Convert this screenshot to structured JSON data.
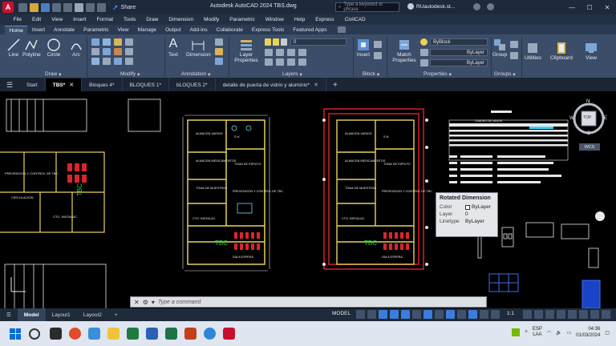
{
  "window": {
    "title": "Autodesk AutoCAD 2024    TBS.dwg",
    "app_letter": "A",
    "share_label": "Share",
    "search_placeholder": "Type a keyword or phrase",
    "user_name": "RUautodesk.st...",
    "controls": [
      "—",
      "☐",
      "✕"
    ]
  },
  "menu": [
    "File",
    "Edit",
    "View",
    "Insert",
    "Format",
    "Tools",
    "Draw",
    "Dimension",
    "Modify",
    "Parametric",
    "Window",
    "Help",
    "Express",
    "CivilCAD"
  ],
  "ribbon_tabs": [
    "Home",
    "Insert",
    "Annotate",
    "Parametric",
    "View",
    "Manage",
    "Output",
    "Add-ins",
    "Collaborate",
    "Express Tools",
    "Featured Apps"
  ],
  "ribbon": {
    "draw_tools": [
      "Line",
      "Polyline",
      "Circle",
      "Arc"
    ],
    "draw_label": "Draw",
    "modify_label": "Modify",
    "text_label": "Text",
    "dimension_label": "Dimension",
    "annotation_label": "Annotation",
    "layer_properties_label": "Layer Properties",
    "layer_value": "0",
    "layers_label": "Layers",
    "insert_label": "Insert",
    "block_label": "Block",
    "match_properties_label": "Match Properties",
    "byblock_value": "ByBlock",
    "bylayer_value_1": "ByLayer",
    "bylayer_value_2": "ByLayer",
    "properties_label": "Properties",
    "group_label": "Group",
    "groups_label": "Groups",
    "utilities_label": "Utilities",
    "clipboard_label": "Clipboard",
    "view_label": "View"
  },
  "file_tabs": [
    {
      "label": "Start",
      "closable": false
    },
    {
      "label": "TBS*",
      "closable": true,
      "active": true
    },
    {
      "label": "Bloques 4*",
      "closable": false
    },
    {
      "label": "BLOQUES 1*",
      "closable": false
    },
    {
      "label": "bLOQUES 2*",
      "closable": false
    },
    {
      "label": "detalle de puerta de vidrio y aluminio*",
      "closable": true
    }
  ],
  "viewcube": {
    "top": "TOP",
    "n": "N",
    "s": "S",
    "w": "W",
    "e": "E",
    "wcs": "WCS"
  },
  "drawing": {
    "legend_title": "CUADRO DE VANOS",
    "tbc_labels": [
      "TBC",
      "TBC",
      "TBC"
    ],
    "room_labels_left": [
      "ALMACEN VARIOS",
      "ALMACEN MEDICAMENTOS",
      "TOMA DE MUESTRAS",
      "PREVENCION Y CONTROL DE TBC",
      "CTO. INSTALAC.",
      "SALA ESPERA",
      "S.H.",
      "TOMA DE ESPUTO"
    ],
    "room_labels_right": [
      "ALMACEN VARIOS",
      "ALMACEN MEDICAMENTOS",
      "TOMA DE MUESTRAS",
      "PREVENCION Y CONTROL DE TBC",
      "CTO. INSTALAC.",
      "SALA ESPERA",
      "S.H.",
      "TOMA DE ESPUTO"
    ],
    "far_left_labels": [
      "PREVENCION Y CONTROL DE TBC",
      "CIRCULACION",
      "CTO. INSTALAC."
    ]
  },
  "tooltip": {
    "title": "Rotated Dimension",
    "rows": [
      {
        "key": "Color",
        "value": "ByLayer"
      },
      {
        "key": "Layer",
        "value": "0"
      },
      {
        "key": "Linetype",
        "value": "ByLayer"
      }
    ]
  },
  "command": {
    "prompt": "Type a command"
  },
  "status": {
    "layout_tabs": [
      "Model",
      "Layout1",
      "Layout2"
    ],
    "model_label": "MODEL",
    "scale": "1:1"
  },
  "taskbar": {
    "lang_1": "ESP",
    "lang_2": "LAA",
    "time": "04:36",
    "date": "01/03/2024"
  },
  "colors": {
    "titlebar": "#1e2a3b",
    "ribbon": "#3b4d68",
    "accent": "#3b7ddd",
    "drawing_bg": "#000000",
    "wall_yellow": "#e8d25a",
    "wall_red": "#e0222a",
    "tbc_green": "#26d43c"
  }
}
